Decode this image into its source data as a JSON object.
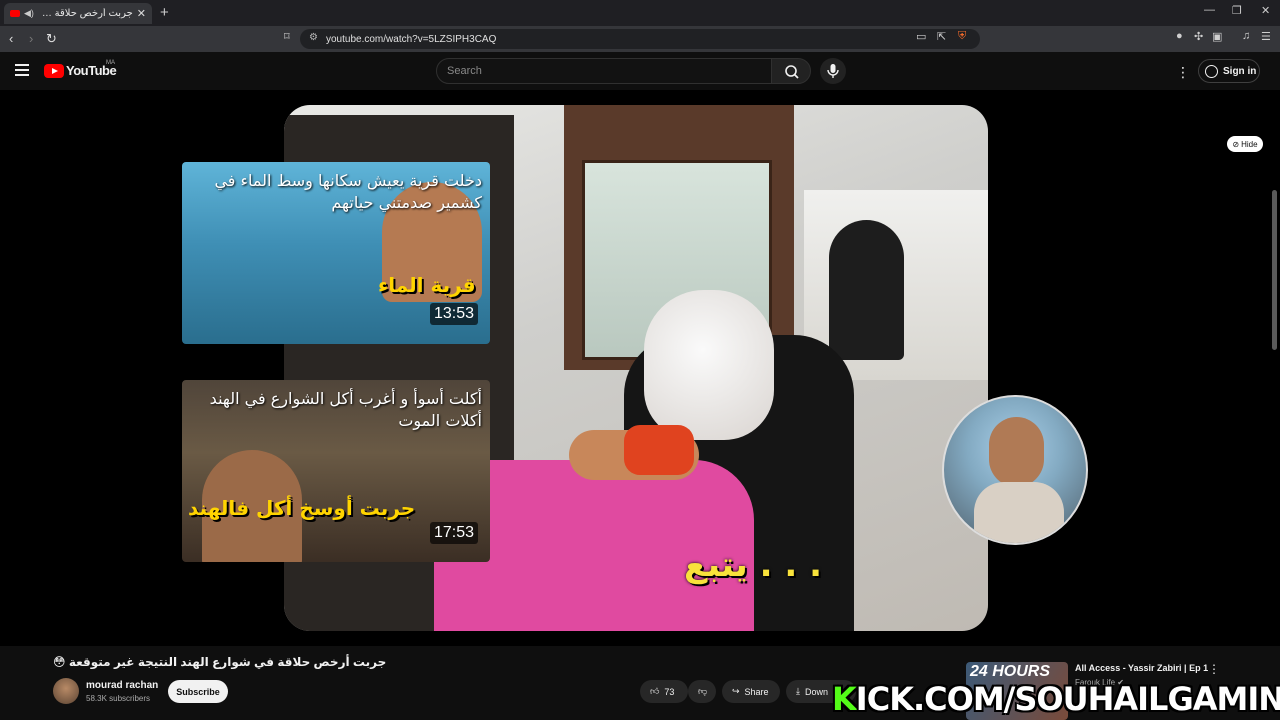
{
  "browser": {
    "tab_title": "جربت أرخص حلاقة في شوارع",
    "url": "youtube.com/watch?v=5LZSIPH3CAQ",
    "new_tab": "+",
    "close": "✕"
  },
  "header": {
    "logo_text": "YouTube",
    "country_code": "MA",
    "search_placeholder": "Search",
    "sign_in": "Sign in"
  },
  "player": {
    "hide_label": "Hide",
    "subtitle_overlay": "يتبع . . .",
    "end_cards": [
      {
        "title": "دخلت قرية يعيش سكانها وسط الماء في كشمير صدمتني حياتهم",
        "big_text": "قرية الماء",
        "duration": "13:53"
      },
      {
        "title": "أكلت أسوأ و أغرب أكل الشوارع في الهند أكلات الموت",
        "big_text": "جربت أوسخ أكل فالهند",
        "duration": "17:53"
      }
    ]
  },
  "video": {
    "title": "جربت أرخص حلاقة في شوارع الهند النتيجة غير متوقعة 😳",
    "channel_name": "mourad rachan",
    "subscribers": "58.3K subscribers",
    "subscribe_label": "Subscribe",
    "like_count": "73",
    "share_label": "Share",
    "download_label": "Down"
  },
  "recommended": {
    "thumb_text": "24 HOURS",
    "title": "All Access - Yassir Zabiri | Ep 1",
    "channel": "Farouk Life"
  },
  "overlay_watermark": {
    "prefix": "K",
    "rest": "ICK.COM/SOUHAILGAMING"
  },
  "colors": {
    "brand_red": "#ff0000",
    "bg": "#0f0f0f",
    "kick_green": "#53fc18",
    "subtitle_yellow": "#f8e23b"
  }
}
